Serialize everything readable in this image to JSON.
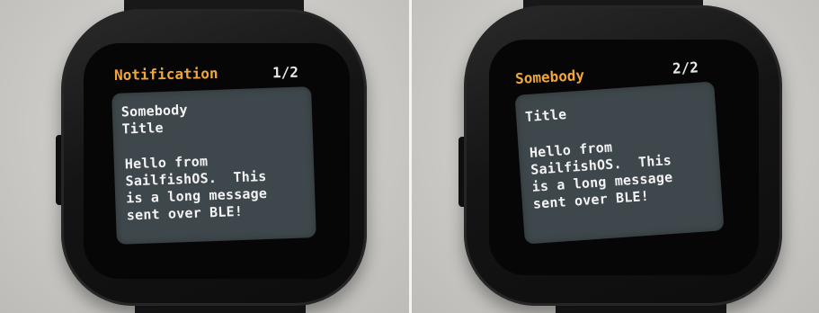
{
  "left_watch": {
    "header_title": "Notification",
    "page_indicator": "1/2",
    "sender": "Somebody",
    "title": "Title",
    "body_lines": [
      "Hello from",
      "SailfishOS.  This",
      "is a long message",
      "sent over BLE!"
    ]
  },
  "right_watch": {
    "header_title": "Somebody",
    "page_indicator": "2/2",
    "title": "Title",
    "body_lines": [
      "Hello from",
      "SailfishOS.  This",
      "is a long message",
      "sent over BLE!"
    ]
  },
  "colors": {
    "header_accent": "#f0a63a",
    "screen_bg": "#3e474b",
    "text": "#f3f3f3"
  }
}
